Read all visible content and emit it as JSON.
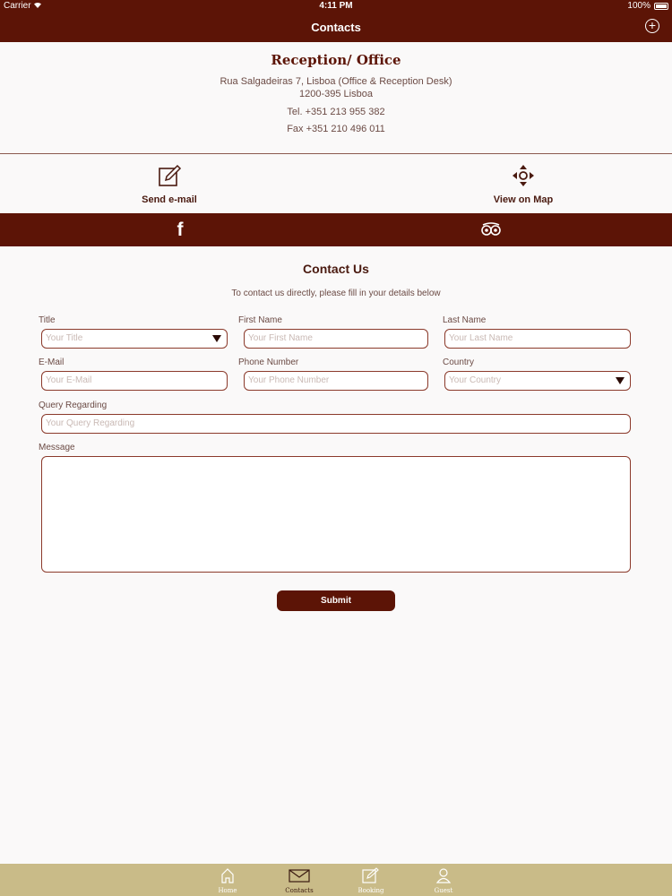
{
  "status_bar": {
    "carrier": "Carrier",
    "time": "4:11 PM",
    "battery": "100%"
  },
  "nav": {
    "title": "Contacts",
    "add_icon": "plus-circle-icon"
  },
  "office": {
    "heading": "Reception/ Office",
    "address_line1": "Rua Salgadeiras 7, Lisboa (Office & Reception Desk)",
    "address_line2": "1200-395 Lisboa",
    "tel": "Tel. +351 213 955 382",
    "fax": "Fax +351 210 496 011"
  },
  "actions": {
    "email_label": "Send e-mail",
    "email_icon": "edit-icon",
    "map_label": "View on Map",
    "map_icon": "map-navigation-icon"
  },
  "social": {
    "facebook_icon": "facebook-icon",
    "tripadvisor_icon": "tripadvisor-icon"
  },
  "form": {
    "title": "Contact Us",
    "subtitle": "To contact us directly, please fill in your details below",
    "title_label": "Title",
    "title_placeholder": "Your Title",
    "first_name_label": "First Name",
    "first_name_placeholder": "Your First Name",
    "last_name_label": "Last Name",
    "last_name_placeholder": "Your Last Name",
    "email_label": "E-Mail",
    "email_placeholder": "Your E-Mail",
    "phone_label": "Phone Number",
    "phone_placeholder": "Your Phone Number",
    "country_label": "Country",
    "country_placeholder": "Your Country",
    "query_label": "Query Regarding",
    "query_placeholder": "Your Query Regarding",
    "message_label": "Message",
    "submit": "Submit"
  },
  "tabs": [
    {
      "label": "Home",
      "icon": "home-icon",
      "active": false
    },
    {
      "label": "Contacts",
      "icon": "envelope-icon",
      "active": true
    },
    {
      "label": "Booking",
      "icon": "booking-icon",
      "active": false
    },
    {
      "label": "Guest",
      "icon": "guest-icon",
      "active": false
    }
  ],
  "colors": {
    "brand": "#5c1406",
    "tab_bar": "#c9bb88",
    "background": "#faf9f9"
  }
}
